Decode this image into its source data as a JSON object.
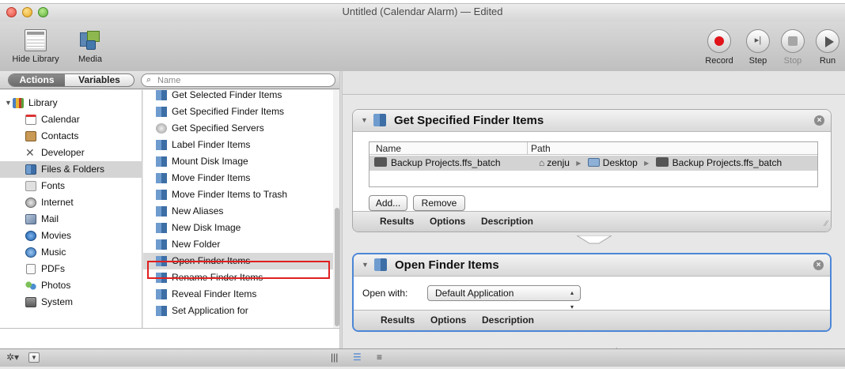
{
  "window": {
    "title": "Untitled (Calendar Alarm) — Edited"
  },
  "toolbar": {
    "hide_library": "Hide Library",
    "media": "Media",
    "record": "Record",
    "step": "Step",
    "stop": "Stop",
    "run": "Run"
  },
  "library": {
    "tab_actions": "Actions",
    "tab_variables": "Variables",
    "search_placeholder": "Name",
    "categories": [
      {
        "label": "Library",
        "icon": "library-icon"
      },
      {
        "label": "Calendar",
        "icon": "calendar-icon"
      },
      {
        "label": "Contacts",
        "icon": "contacts-icon"
      },
      {
        "label": "Developer",
        "icon": "developer-icon"
      },
      {
        "label": "Files & Folders",
        "icon": "finder-icon",
        "selected": true
      },
      {
        "label": "Fonts",
        "icon": "fonts-icon"
      },
      {
        "label": "Internet",
        "icon": "internet-icon"
      },
      {
        "label": "Mail",
        "icon": "mail-icon"
      },
      {
        "label": "Movies",
        "icon": "movies-icon"
      },
      {
        "label": "Music",
        "icon": "music-icon"
      },
      {
        "label": "PDFs",
        "icon": "pdf-icon"
      },
      {
        "label": "Photos",
        "icon": "photos-icon"
      },
      {
        "label": "System",
        "icon": "system-icon"
      }
    ],
    "actions": [
      "Get Selected Finder Items",
      "Get Specified Finder Items",
      "Get Specified Servers",
      "Label Finder Items",
      "Mount Disk Image",
      "Move Finder Items",
      "Move Finder Items to Trash",
      "New Aliases",
      "New Disk Image",
      "New Folder",
      "Open Finder Items",
      "Rename Finder Items",
      "Reveal Finder Items",
      "Set Application for"
    ],
    "highlighted_action": "Open Finder Items"
  },
  "workflow": {
    "actions": [
      {
        "title": "Get Specified Finder Items",
        "columns": [
          "Name",
          "Path"
        ],
        "rows": [
          {
            "name": "Backup Projects.ffs_batch",
            "path": [
              "zenju",
              "Desktop",
              "Backup Projects.ffs_batch"
            ]
          }
        ],
        "add_button": "Add...",
        "remove_button": "Remove",
        "tabs": [
          "Results",
          "Options",
          "Description"
        ]
      },
      {
        "title": "Open Finder Items",
        "open_with_label": "Open with:",
        "open_with_value": "Default Application",
        "tabs": [
          "Results",
          "Options",
          "Description"
        ]
      }
    ]
  },
  "colors": {
    "highlight_frame": "#e02020",
    "active_border": "#4c86d6",
    "record": "#e0141a"
  }
}
